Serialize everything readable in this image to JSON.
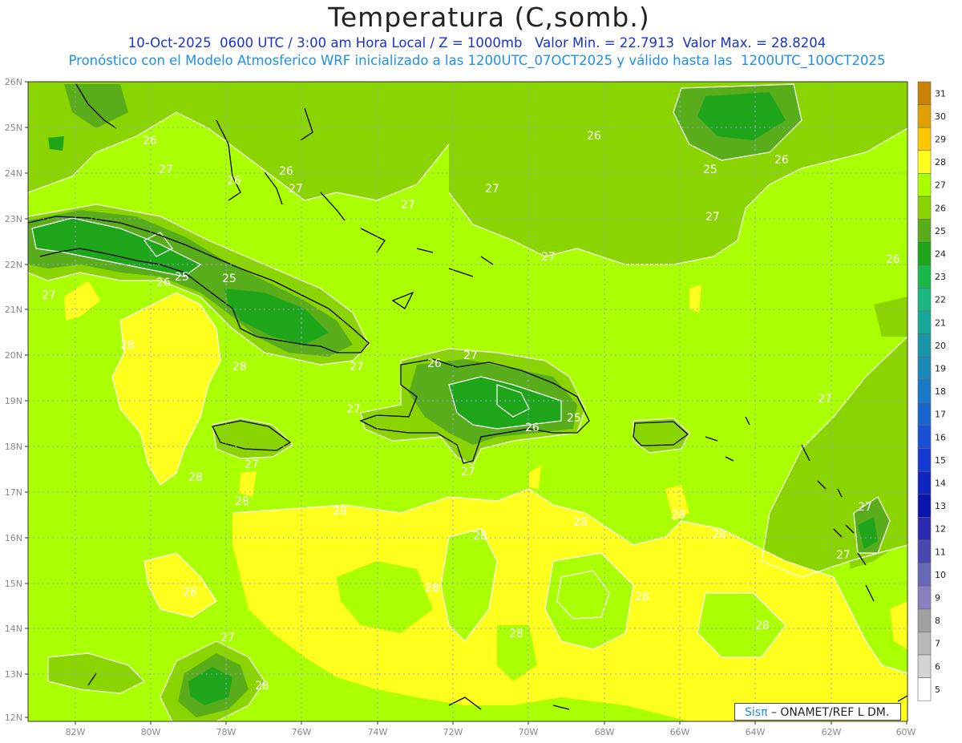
{
  "header": {
    "title": "Temperatura (C,somb.)",
    "subtitle_line1": "10-Oct-2025  0600 UTC / 3:00 am Hora Local / Z = 1000mb   Valor Min. = 22.7913  Valor Max. = 28.8204",
    "subtitle_line2": "Pronóstico con el Modelo Atmosferico WRF inicializado a las 1200UTC_07OCT2025 y válido hasta las  1200UTC_10OCT2025"
  },
  "map": {
    "lat_labels": [
      "26N",
      "25N",
      "24N",
      "23N",
      "22N",
      "21N",
      "20N",
      "19N",
      "18N",
      "17N",
      "16N",
      "15N",
      "14N",
      "13N",
      "12N"
    ],
    "lon_labels": [
      "82W",
      "80W",
      "78W",
      "76W",
      "74W",
      "72W",
      "70W",
      "68W",
      "66W",
      "64W",
      "62W",
      "60W"
    ],
    "contour_labels": [
      {
        "text": "26"
      },
      {
        "text": "27"
      },
      {
        "text": "26"
      },
      {
        "text": "27"
      },
      {
        "text": "27"
      },
      {
        "text": "27"
      },
      {
        "text": "26"
      },
      {
        "text": "25"
      },
      {
        "text": "26"
      },
      {
        "text": "25"
      },
      {
        "text": "27"
      },
      {
        "text": "27"
      },
      {
        "text": "26"
      },
      {
        "text": "25"
      },
      {
        "text": "27"
      },
      {
        "text": "27"
      },
      {
        "text": "27"
      },
      {
        "text": "26"
      },
      {
        "text": "27"
      },
      {
        "text": "28"
      },
      {
        "text": "28"
      },
      {
        "text": "27"
      },
      {
        "text": "28"
      },
      {
        "text": "28"
      },
      {
        "text": "28"
      },
      {
        "text": "28"
      },
      {
        "text": "28"
      },
      {
        "text": "28"
      },
      {
        "text": "27"
      },
      {
        "text": "28"
      },
      {
        "text": "28"
      },
      {
        "text": "28"
      },
      {
        "text": "28"
      },
      {
        "text": "28"
      },
      {
        "text": "28"
      },
      {
        "text": "27"
      },
      {
        "text": "27"
      },
      {
        "text": "27"
      },
      {
        "text": "26"
      },
      {
        "text": "27"
      },
      {
        "text": "28"
      },
      {
        "text": "26"
      },
      {
        "text": "26"
      },
      {
        "text": "25"
      }
    ],
    "colors": {
      "c28": "#ffff1e",
      "c27": "#aaff00",
      "c26": "#8ad400",
      "c25": "#5aad1a",
      "c24": "#1ea519",
      "c23": "#18b84a",
      "grid": "#9c9cf0",
      "contour": "#ffffff",
      "coast": "#000000"
    }
  },
  "colorbar": {
    "labels": [
      "31",
      "30",
      "29",
      "28",
      "27",
      "26",
      "25",
      "24",
      "23",
      "22",
      "21",
      "20",
      "19",
      "18",
      "17",
      "16",
      "15",
      "14",
      "13",
      "12",
      "11",
      "10",
      "9",
      "8",
      "7",
      "6",
      "5"
    ],
    "colors": [
      "#c88200",
      "#e0a000",
      "#ffc800",
      "#ffff1e",
      "#aaff00",
      "#8ad400",
      "#5aad1a",
      "#1ea519",
      "#18b84a",
      "#1ab880",
      "#18a898",
      "#1896a8",
      "#1a88b8",
      "#1a78c8",
      "#1a66d0",
      "#1a50d8",
      "#1638d2",
      "#1024c0",
      "#0c14b0",
      "#2a2ab0",
      "#4848b0",
      "#6868b8",
      "#8a80c0",
      "#a0a0a0",
      "#b8b8b8",
      "#d4d4d4",
      "#ffffff"
    ]
  },
  "credit": {
    "brand": "Sisπ",
    "text": " – ONAMET/REF L DM."
  }
}
